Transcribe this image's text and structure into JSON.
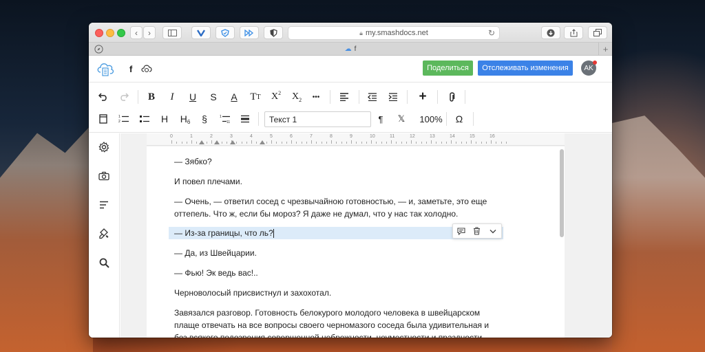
{
  "browser": {
    "address": "my.smashdocs.net",
    "tab_title": "f"
  },
  "app": {
    "doc_title": "f",
    "share_label": "Поделиться",
    "track_label": "Отслеживать изменения",
    "avatar_initials": "AK"
  },
  "toolbar": {
    "row1": [
      "undo",
      "redo",
      "B",
      "I",
      "U",
      "S",
      "A",
      "TT",
      "X²",
      "X₂",
      "•••",
      "align-left",
      "outdent",
      "indent",
      "+",
      "attachment"
    ],
    "style_value": "Текст 1",
    "pilcrow": "¶",
    "clear": "𝕏",
    "zoom": "100%",
    "omega": "Ω",
    "h_label": "H",
    "h6_label": "H",
    "h6_sub": "6",
    "section": "§",
    "italic": "I",
    "underline": "U",
    "strike": "S",
    "bold": "B",
    "font_color": "A",
    "text_size": "T",
    "text_size_small": "T",
    "sup_x": "X",
    "sup_2": "2",
    "sub_x": "X",
    "sub_2": "2",
    "more": "•••",
    "plus": "+"
  },
  "ruler": {
    "numbers": [
      "0",
      "1",
      "2",
      "3",
      "4",
      "5",
      "6",
      "7",
      "8",
      "9",
      "10",
      "11",
      "12",
      "13",
      "14",
      "15",
      "16"
    ]
  },
  "document": {
    "paragraphs": [
      "— Зябко?",
      "И повел плечами.",
      "— Очень, — ответил сосед с чрезвычайною готовностью, — и, заметьте, это еще оттепель. Что ж, если бы мороз? Я даже не думал, что у нас так холодно.",
      "— Из-за границы, что ль?",
      "— Да, из Швейцарии.",
      "— Фью! Эк ведь вас!..",
      "Черноволосый присвистнул и захохотал.",
      "Завязался разговор. Готовность белокурого молодого человека в швейцарском плаще отвечать на все вопросы своего черномазого соседа была удивительная и без всякого подозрения совершенной небрежности, неуместности и праздности"
    ]
  },
  "colors": {
    "share_green": "#5cb85c",
    "track_blue": "#3b82e7",
    "highlight": "#dcebf9",
    "avatar_dot": "#e53935"
  }
}
